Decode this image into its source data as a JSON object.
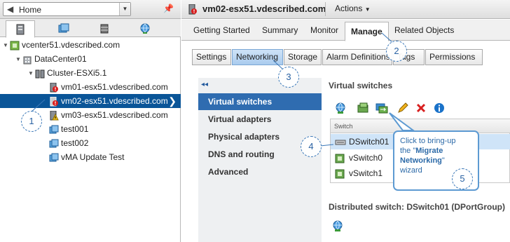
{
  "nav": {
    "home_label": "Home"
  },
  "tree": {
    "vcenter": "vcenter51.vdescribed.com",
    "datacenter": "DataCenter01",
    "cluster": "Cluster-ESXi5.1",
    "hosts": [
      "vm01-esx51.vdescribed.com",
      "vm02-esx51.vdescribed.com",
      "vm03-esx51.vdescribed.com"
    ],
    "vms": [
      "test001",
      "test002",
      "vMA Update Test"
    ]
  },
  "header": {
    "title": "vm02-esx51.vdescribed.com",
    "actions": "Actions"
  },
  "main_tabs": [
    "Getting Started",
    "Summary",
    "Monitor",
    "Manage",
    "Related Objects"
  ],
  "sub_tabs": [
    "Settings",
    "Networking",
    "Storage",
    "Alarm Definitions",
    "Tags",
    "Permissions"
  ],
  "inner_nav": {
    "collapse": "◂◂",
    "items": [
      "Virtual switches",
      "Virtual adapters",
      "Physical adapters",
      "DNS and routing",
      "Advanced"
    ]
  },
  "virtual_switches": {
    "title": "Virtual switches",
    "column": "Switch",
    "rows": [
      "DSwitch01",
      "vSwitch0",
      "vSwitch1"
    ],
    "distributed_title": "Distributed switch: DSwitch01 (DPortGroup)"
  },
  "callouts": [
    "1",
    "2",
    "3",
    "4",
    "5"
  ],
  "tooltip": {
    "line1": "Click to bring-up",
    "line2_pre": "the \"",
    "line2_bold": "Migrate",
    "line3_bold": "Networking",
    "line3_post": "\"",
    "line4": "wizard"
  },
  "colors": {
    "selection": "#0a5598",
    "accent": "#2f6cb0",
    "callout": "#3b78b8"
  }
}
